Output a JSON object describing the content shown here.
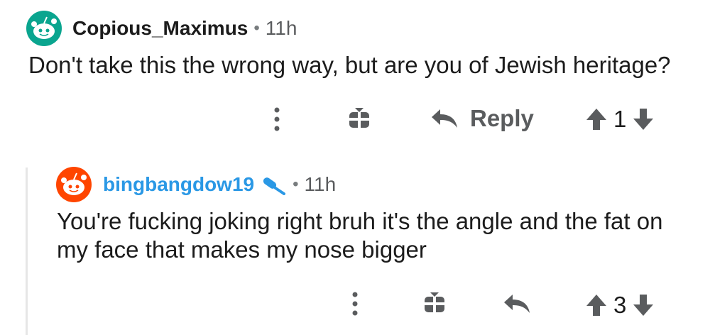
{
  "comments": [
    {
      "username": "Copious_Maximus",
      "separator": "•",
      "time": "11h",
      "body": "Don't take this the wrong way, but are you of Jewish heritage?",
      "reply_label": "Reply",
      "vote_count": "1",
      "avatar_color": "#0aa58f",
      "icons": [
        "more-icon",
        "award-icon",
        "reply-icon",
        "upvote-icon",
        "downvote-icon"
      ]
    },
    {
      "username": "bingbangdow19",
      "separator": "•",
      "time": "11h",
      "body": "You're fucking joking right bruh it's the angle and the fat on my face that makes my nose bigger",
      "vote_count": "3",
      "username_color": "#2a98e5",
      "avatar_color": "#ff4500",
      "icons": [
        "mic-icon",
        "more-icon",
        "award-icon",
        "reply-icon",
        "upvote-icon",
        "downvote-icon"
      ]
    }
  ]
}
